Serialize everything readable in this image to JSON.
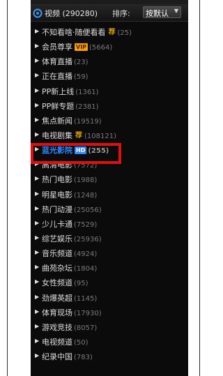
{
  "header": {
    "title": "视频",
    "total": "(290280)",
    "sort_label": "排序:",
    "sort_value": "按默认"
  },
  "channels": [
    {
      "label": "不知看啥·随便看看",
      "badge": "荐",
      "badge_type": "rec",
      "count": "(25)"
    },
    {
      "label": "会员尊享",
      "badge": "VIP",
      "badge_type": "vip",
      "count": "(5664)"
    },
    {
      "label": "体育直播",
      "count": "(23)"
    },
    {
      "label": "正在直播",
      "count": "(59)"
    },
    {
      "label": "PP新上线",
      "count": "(1361)"
    },
    {
      "label": "PP鲜专题",
      "count": "(2381)"
    },
    {
      "label": "焦点新闻",
      "count": "(19519)"
    },
    {
      "label": "电视剧集",
      "badge": "荐",
      "badge_type": "rec",
      "count": "(108121)"
    },
    {
      "label": "蓝光影院",
      "badge": "HD",
      "badge_type": "hd",
      "count": "(255)",
      "highlighted": true
    },
    {
      "label": "高清电影",
      "count": "(7572)"
    },
    {
      "label": "热门电影",
      "count": "(1988)"
    },
    {
      "label": "明星电影",
      "count": "(1248)"
    },
    {
      "label": "热门动漫",
      "count": "(25056)"
    },
    {
      "label": "少儿卡通",
      "count": "(7529)"
    },
    {
      "label": "综艺娱乐",
      "count": "(25936)"
    },
    {
      "label": "音乐频道",
      "count": "(4924)"
    },
    {
      "label": "曲苑杂坛",
      "count": "(1804)"
    },
    {
      "label": "女性频道",
      "count": "(95)"
    },
    {
      "label": "劲爆英超",
      "count": "(1145)"
    },
    {
      "label": "体育现场",
      "count": "(17930)"
    },
    {
      "label": "游戏竞技",
      "count": "(8057)"
    },
    {
      "label": "电视频道",
      "count": "(50)"
    },
    {
      "label": "纪录中国",
      "count": "(783)"
    }
  ],
  "colors": {
    "panel_bg": "#0b0b0b",
    "highlight_text": "#2f86ff",
    "annotation_box": "#e01010",
    "vip_badge": "#f0a000"
  }
}
